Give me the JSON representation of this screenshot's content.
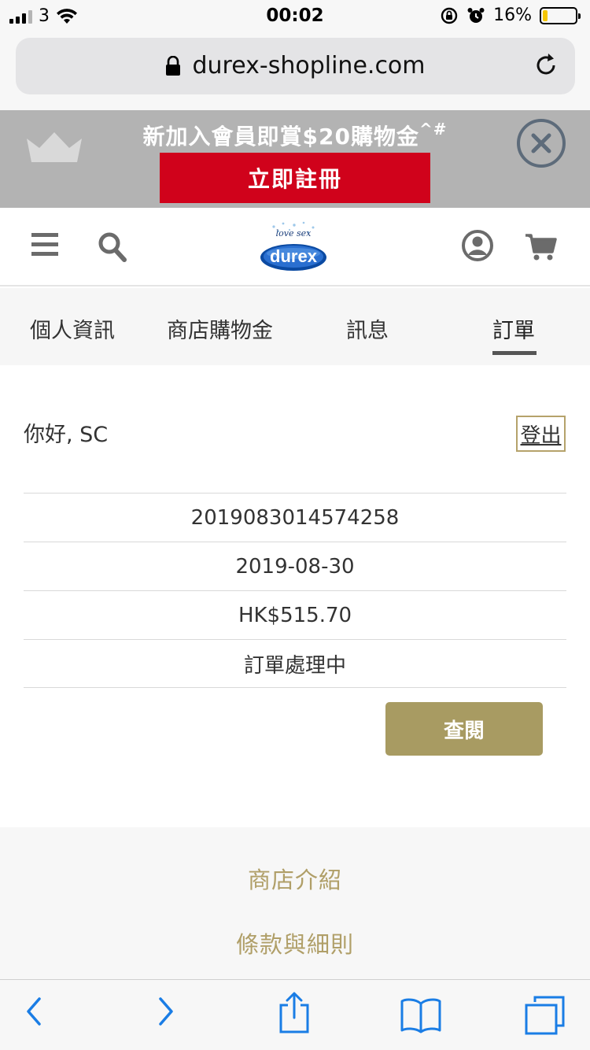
{
  "status_bar": {
    "carrier": "3",
    "time": "00:02",
    "battery_percent": "16%",
    "battery_level": 0.16,
    "battery_color": "#f5c600"
  },
  "browser": {
    "url": "durex-shopline.com",
    "icons": [
      "lock-icon",
      "reload-icon"
    ]
  },
  "promo": {
    "text": "新加入會員即賞$20購物金",
    "text_suffix": "^#",
    "register_label": "立即註冊",
    "accent_color": "#d0021b",
    "icons": [
      "crown-icon",
      "close-icon"
    ]
  },
  "header": {
    "logo_tagline": "love sex",
    "logo_text": "durex",
    "icons": [
      "menu-icon",
      "search-icon",
      "user-icon",
      "cart-icon"
    ]
  },
  "tabs": [
    {
      "label": "個人資訊",
      "active": false
    },
    {
      "label": "商店購物金",
      "active": false
    },
    {
      "label": "訊息",
      "active": false
    },
    {
      "label": "訂單",
      "active": true
    }
  ],
  "account": {
    "greeting": "你好, SC",
    "logout_label": "登出"
  },
  "order": {
    "number": "2019083014574258",
    "date": "2019-08-30",
    "total": "HK$515.70",
    "status": "訂單處理中",
    "view_label": "查閱",
    "button_color": "#a89b62"
  },
  "footer": {
    "links": [
      "商店介紹",
      "條款與細則"
    ],
    "link_color": "#b09f68"
  },
  "toolbar": {
    "icons": [
      "back-icon",
      "forward-icon",
      "share-icon",
      "bookmarks-icon",
      "tabs-icon"
    ],
    "accent_color": "#1a7de5"
  }
}
